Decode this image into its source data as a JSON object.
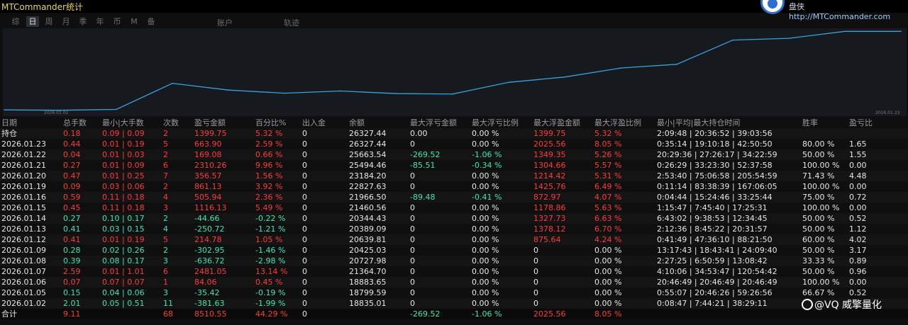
{
  "app_title": "MTCommander统计",
  "brand": {
    "name": "盘侠",
    "url": "http://MTCommander.com"
  },
  "tabs": [
    {
      "label": "综",
      "active": false
    },
    {
      "label": "日",
      "active": true
    },
    {
      "label": "周",
      "active": false
    },
    {
      "label": "月",
      "active": false
    },
    {
      "label": "季",
      "active": false
    },
    {
      "label": "年",
      "active": false
    },
    {
      "label": "币",
      "active": false
    },
    {
      "label": "M",
      "active": false
    },
    {
      "label": "备",
      "active": false
    }
  ],
  "account_label": "账户",
  "track_label": "轨迹",
  "chart_data": {
    "type": "line",
    "x_start_label": "2026.01.02",
    "x_end_label": "2026.01.23",
    "x": [
      "2026.01.02",
      "2026.01.05",
      "2026.01.06",
      "2026.01.07",
      "2026.01.08",
      "2026.01.09",
      "2026.01.12",
      "2026.01.13",
      "2026.01.14",
      "2026.01.15",
      "2026.01.16",
      "2026.01.19",
      "2026.01.20",
      "2026.01.21",
      "2026.01.22",
      "2026.01.23",
      "持仓"
    ],
    "y": [
      18835.01,
      18799.59,
      18883.65,
      21364.7,
      20727.98,
      20425.03,
      20639.81,
      20389.09,
      20344.43,
      21460.56,
      21966.5,
      22827.63,
      23184.2,
      25494.46,
      25663.54,
      26327.44,
      26327.44
    ],
    "color": "#3aa0e0"
  },
  "table": {
    "headers": [
      "日期",
      "总手数",
      "最小|大手数",
      "次数",
      "盈亏金额",
      "百分比%",
      "出入金",
      "余额",
      "最大浮亏金额",
      "最大浮亏比例",
      "最大浮盈金额",
      "最大浮盈比例",
      "最小|平均|最大持仓时间",
      "胜率",
      "盈亏比"
    ],
    "rows": [
      [
        "持仓",
        "0.18",
        "0.09 | 0.09",
        "2",
        "1399.75",
        "5.32 %",
        "0",
        "26327.44",
        "0.00",
        "0.00 %",
        "1399.75",
        "5.32 %",
        "2:09:48 | 20:36:52 | 39:03:56",
        "",
        ""
      ],
      [
        "2026.01.23",
        "0.44",
        "0.01 | 0.19",
        "5",
        "663.90",
        "2.59 %",
        "0",
        "26327.44",
        "0",
        "0.00 %",
        "2025.56",
        "8.05 %",
        "0:35:14 | 19:10:18 | 42:50:50",
        "80.00 %",
        "1.65"
      ],
      [
        "2026.01.22",
        "0.04",
        "0.01 | 0.03",
        "2",
        "169.08",
        "0.66 %",
        "0",
        "25663.54",
        "-269.52",
        "-1.06 %",
        "1349.35",
        "5.26 %",
        "20:29:36 | 27:26:17 | 34:22:59",
        "50.00 %",
        "1.55"
      ],
      [
        "2026.01.21",
        "0.27",
        "0.01 | 0.09",
        "6",
        "2310.26",
        "9.96 %",
        "0",
        "25494.46",
        "-85.51",
        "-0.34 %",
        "1304.66",
        "5.57 %",
        "0:26:29 | 33:23:30 | 52:37:58",
        "100.00 %",
        "0.00"
      ],
      [
        "2026.01.20",
        "0.47",
        "0.01 | 0.25",
        "7",
        "356.57",
        "1.56 %",
        "0",
        "23184.20",
        "0",
        "0.00 %",
        "1214.42",
        "5.31 %",
        "2:53:40 | 75:06:58 | 205:54:59",
        "71.43 %",
        "4.48"
      ],
      [
        "2026.01.19",
        "0.09",
        "0.03 | 0.06",
        "2",
        "861.13",
        "3.92 %",
        "0",
        "22827.63",
        "0",
        "0.00 %",
        "1425.76",
        "6.49 %",
        "0:11:14 | 83:38:39 | 167:06:05",
        "100.00 %",
        "0.00"
      ],
      [
        "2026.01.16",
        "0.59",
        "0.11 | 0.18",
        "4",
        "505.94",
        "2.36 %",
        "0",
        "21966.50",
        "-89.48",
        "-0.41 %",
        "872.97",
        "4.07 %",
        "0:04:44 | 15:24:46 | 33:25:44",
        "75.00 %",
        "0.72"
      ],
      [
        "2026.01.15",
        "0.45",
        "0.11 | 0.18",
        "3",
        "1116.13",
        "5.49 %",
        "0",
        "21460.56",
        "0",
        "0.00 %",
        "1178.86",
        "5.63 %",
        "1:15:47 | 7:45:40 | 17:25:31",
        "100.00 %",
        "0.00"
      ],
      [
        "2026.01.14",
        "0.27",
        "0.10 | 0.17",
        "2",
        "-44.66",
        "-0.22 %",
        "0",
        "20344.43",
        "0",
        "0.00 %",
        "1327.73",
        "6.63 %",
        "6:43:02 | 9:38:53 | 12:34:45",
        "50.00 %",
        "0.52"
      ],
      [
        "2026.01.13",
        "0.41",
        "0.03 | 0.15",
        "4",
        "-250.72",
        "-1.21 %",
        "0",
        "20389.09",
        "0",
        "0.00 %",
        "1378.12",
        "6.70 %",
        "2:12:36 | 8:45:22 | 20:31:57",
        "50.00 %",
        "1.12"
      ],
      [
        "2026.01.12",
        "0.41",
        "0.01 | 0.19",
        "5",
        "214.78",
        "1.05 %",
        "0",
        "20639.81",
        "0",
        "0.00 %",
        "875.64",
        "4.24 %",
        "0:41:49 | 47:36:10 | 88:21:50",
        "60.00 %",
        "4.02"
      ],
      [
        "2026.01.09",
        "0.28",
        "0.02 | 0.26",
        "2",
        "-302.95",
        "-1.46 %",
        "0",
        "20425.03",
        "0",
        "0.00 %",
        "0",
        "0.00 %",
        "13:17:43 | 18:43:41 | 24:09:40",
        "50.00 %",
        "3.17"
      ],
      [
        "2026.01.08",
        "0.39",
        "0.08 | 0.17",
        "3",
        "-636.72",
        "-2.98 %",
        "0",
        "20727.98",
        "0",
        "0.00 %",
        "0",
        "0.00 %",
        "2:27:25 | 6:50:59 | 13:08:42",
        "33.33 %",
        "0.89"
      ],
      [
        "2026.01.07",
        "2.59",
        "0.01 | 1.01",
        "6",
        "2481.05",
        "13.14 %",
        "0",
        "21364.70",
        "0",
        "0.00 %",
        "0",
        "0.00 %",
        "4:10:06 | 34:53:47 | 120:54:42",
        "50.00 %",
        "0.96"
      ],
      [
        "2026.01.06",
        "0.07",
        "0.07 | 0.07",
        "1",
        "84.06",
        "0.45 %",
        "0",
        "18883.65",
        "0",
        "0.00 %",
        "0",
        "0.00 %",
        "20:46:49 | 20:46:49 | 20:46:49",
        "100.00 %",
        "0.00"
      ],
      [
        "2026.01.05",
        "0.15",
        "0.04 | 0.06",
        "3",
        "-35.42",
        "-0.19 %",
        "0",
        "18799.59",
        "0",
        "0.00 %",
        "0",
        "0.00 %",
        "0:55:07 | 20:46:26 | 59:26:56",
        "66.67 %",
        "0.52"
      ],
      [
        "2026.01.02",
        "2.01",
        "0.05 | 0.51",
        "11",
        "-381.63",
        "-1.99 %",
        "0",
        "18835.01",
        "0",
        "0.00 %",
        "0",
        "0.00 %",
        "0:08:47 | 7:44:21 | 38:29:11",
        "",
        ""
      ]
    ],
    "total": [
      "合计",
      "9.11",
      "",
      "68",
      "8510.55",
      "44.29 %",
      "0",
      "",
      "-269.52",
      "-1.06 %",
      "2025.56",
      "8.05 %",
      "",
      "",
      ""
    ]
  },
  "watermark": "@VQ 威擎量化"
}
